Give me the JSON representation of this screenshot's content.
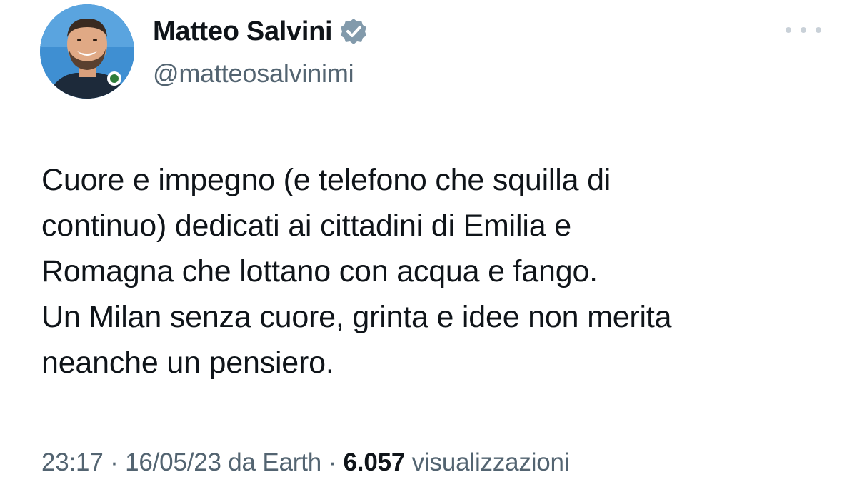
{
  "author": {
    "display_name": "Matteo Salvini",
    "handle": "@matteosalvinimi",
    "verified": true,
    "avatar_icon": "profile-photo"
  },
  "more_icon": "more-horizontal-icon",
  "tweet": {
    "lines": [
      "Cuore e impegno (e telefono che squilla di",
      "continuo) dedicati ai cittadini di Emilia e",
      "Romagna che lottano con acqua e fango.",
      "Un Milan senza cuore, grinta e idee non merita",
      "neanche un pensiero."
    ]
  },
  "meta": {
    "time": "23:17",
    "separator": "·",
    "date": "16/05/23",
    "source": "da Earth",
    "views_count": "6.057",
    "views_label": "visualizzazioni"
  },
  "colors": {
    "text_primary": "#0f1419",
    "text_secondary": "#536471",
    "verified_badge": "#829aab"
  }
}
